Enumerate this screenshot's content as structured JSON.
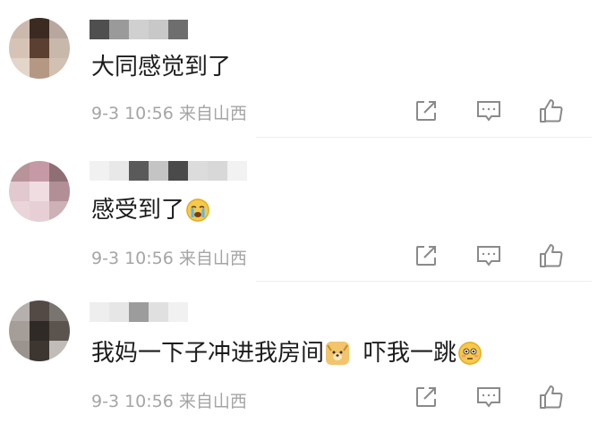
{
  "comments": [
    {
      "text": "大同感觉到了",
      "emoji": "",
      "text_after": "",
      "emoji_end": "",
      "date": "9-3 10:56",
      "location": "来自山西",
      "avatar_colors": [
        "#cbb9ae",
        "#3a2a22",
        "#b7a79e",
        "#d7c3b6",
        "#5b3f30",
        "#c8b7ab",
        "#e4d5c9",
        "#b49883",
        "#d2c0b3"
      ],
      "username_colors": [
        "#4f4f4f",
        "#9a9a9a",
        "#d0d0d0",
        "#c8c8c8",
        "#6e6e6e"
      ]
    },
    {
      "text": "感受到了",
      "emoji": "crying-face",
      "text_after": "",
      "emoji_end": "",
      "date": "9-3 10:56",
      "location": "来自山西",
      "avatar_colors": [
        "#b8939a",
        "#c59aa6",
        "#8e6f74",
        "#e1c9cf",
        "#f0dde2",
        "#b28f96",
        "#ead5da",
        "#e6d0d6",
        "#cdb1b7"
      ],
      "username_colors": [
        "#f1f1f1",
        "#e8e8e8",
        "#5a5a5a",
        "#c4c4c4",
        "#4a4a4a",
        "#dcdcdc",
        "#d8d8d8",
        "#f2f2f2"
      ]
    },
    {
      "text": "我妈一下子冲进我房间",
      "emoji": "dog-face",
      "text_after": "吓我一跳",
      "emoji_end": "flushed-face",
      "date": "9-3 10:56",
      "location": "来自山西",
      "avatar_colors": [
        "#b5b0ad",
        "#534a45",
        "#7a7470",
        "#a49d98",
        "#2f2a26",
        "#5a534e",
        "#9b938e",
        "#3c3530",
        "#c2bcb8"
      ],
      "username_colors": [
        "#eeeeee",
        "#e6e6e6",
        "#9c9c9c",
        "#e0e0e0",
        "#f1f1f1"
      ]
    }
  ],
  "icon_color": "#8a8a8a",
  "icons": [
    "share-icon",
    "comment-icon",
    "like-icon"
  ]
}
